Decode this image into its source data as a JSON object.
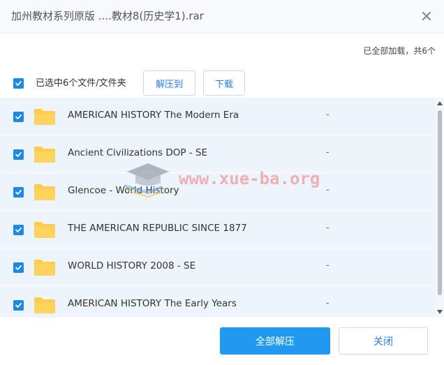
{
  "dialog": {
    "title": "加州教材系列原版 ....教材8(历史学1).rar",
    "loaded_status": "已全部加载，共6个"
  },
  "toolbar": {
    "selected_text": "已选中6个文件/文件夹",
    "extract_to_label": "解压到",
    "download_label": "下载"
  },
  "files": [
    {
      "name": "AMERICAN HISTORY The Modern Era",
      "size": "-"
    },
    {
      "name": "Ancient Civilizations DOP - SE",
      "size": "-"
    },
    {
      "name": "Glencoe - World History",
      "size": "-"
    },
    {
      "name": "THE AMERICAN REPUBLIC SINCE 1877",
      "size": "-"
    },
    {
      "name": "WORLD HISTORY 2008 - SE",
      "size": "-"
    },
    {
      "name": "AMERICAN HISTORY The Early Years",
      "size": "-"
    }
  ],
  "watermark": {
    "text": "www.xue-ba.org"
  },
  "footer": {
    "extract_all_label": "全部解压",
    "close_label": "关闭"
  },
  "colors": {
    "accent": "#1f9af0",
    "link": "#2b7de9",
    "row_bg": "#edf4fc",
    "folder": "#ffcd4a"
  },
  "icons": {
    "close": "close-icon",
    "checkbox": "checkbox-checked-icon",
    "folder": "folder-icon",
    "watermark": "graduation-cap-icon"
  }
}
